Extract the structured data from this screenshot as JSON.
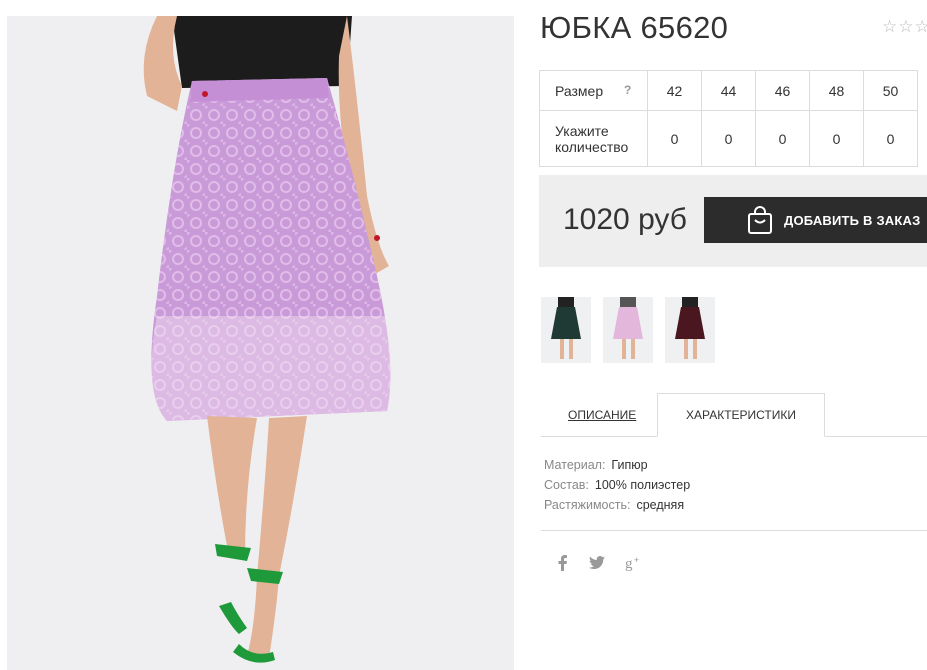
{
  "product": {
    "title": "ЮБКА 65620",
    "rating_stars": "☆☆☆",
    "image_alt": "product-photo"
  },
  "sizes": {
    "size_label": "Размер",
    "help": "?",
    "qty_label_line1": "Укажите",
    "qty_label_line2": "количество",
    "values": [
      "42",
      "44",
      "46",
      "48",
      "50"
    ],
    "quantities": [
      "0",
      "0",
      "0",
      "0",
      "0"
    ]
  },
  "purchase": {
    "price": "1020 руб",
    "add_button": "ДОБАВИТЬ В ЗАКАЗ"
  },
  "variants": [
    {
      "color": "#1f3a34"
    },
    {
      "color": "#e3b6dc"
    },
    {
      "color": "#4a1620"
    }
  ],
  "tabs": {
    "description": "ОПИСАНИЕ",
    "characteristics": "ХАРАКТЕРИСТИКИ"
  },
  "characteristics": [
    {
      "key": "Материал:",
      "value": "Гипюр"
    },
    {
      "key": "Состав:",
      "value": "100% полиэстер"
    },
    {
      "key": "Растяжимость:",
      "value": "средняя"
    }
  ],
  "social": {
    "facebook": "f",
    "twitter": "🐦",
    "gplus": "g+"
  },
  "colors": {
    "button_bg": "#2c2c2c",
    "skirt": "#c99ad8",
    "shoes": "#1f9a3a"
  }
}
